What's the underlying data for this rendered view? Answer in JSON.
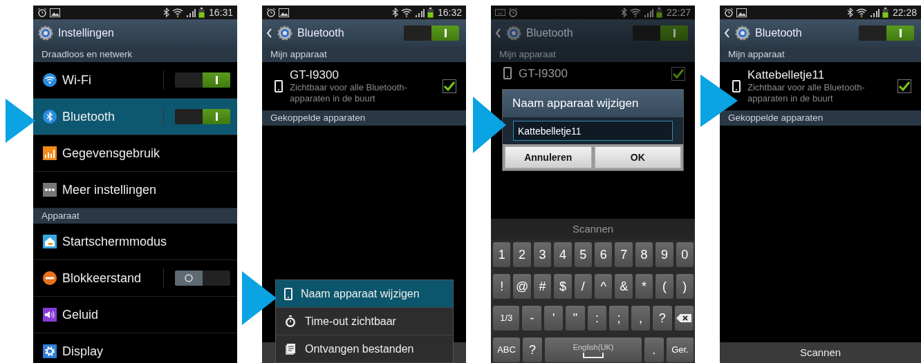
{
  "screens": [
    {
      "kind": "settings",
      "status_bar": {
        "time": "16:31"
      },
      "header": {
        "title": "Instellingen",
        "back": false
      },
      "sections": [
        {
          "title": "Draadloos en netwerk",
          "items": [
            {
              "label": "Wi-Fi",
              "selected": false,
              "on": true
            },
            {
              "label": "Bluetooth",
              "selected": true,
              "on": true
            },
            {
              "label": "Gegevensgebruik",
              "selected": false
            },
            {
              "label": "Meer instellingen",
              "selected": false
            }
          ]
        },
        {
          "title": "Apparaat",
          "items": [
            {
              "label": "Startschermmodus",
              "selected": false
            },
            {
              "label": "Blokkeerstand",
              "selected": false,
              "on": false
            },
            {
              "label": "Geluid",
              "selected": false
            },
            {
              "label": "Display",
              "selected": false
            }
          ]
        }
      ]
    },
    {
      "kind": "bluetooth",
      "dimmed": false,
      "status_bar": {
        "time": "16:32"
      },
      "header": {
        "title": "Bluetooth",
        "back": true,
        "on": true
      },
      "sections": [
        {
          "title": "Mijn apparaat",
          "device": {
            "name": "GT-I9300",
            "description": "Zichtbaar voor alle Bluetooth-apparaten in de buurt",
            "checked": true
          }
        },
        {
          "title": "Gekoppelde apparaten"
        }
      ],
      "menu": [
        {
          "label": "Naam apparaat wijzigen",
          "selected": true
        },
        {
          "label": "Time-out zichtbaar",
          "selected": false
        },
        {
          "label": "Ontvangen bestanden",
          "selected": false
        }
      ]
    },
    {
      "kind": "bluetooth",
      "dimmed": true,
      "status_bar": {
        "time": "22:27"
      },
      "header": {
        "title": "Bluetooth",
        "back": true,
        "on": true
      },
      "sections": [
        {
          "title": "Mijn apparaat",
          "device": {
            "name": "GT-I9300",
            "checked": true
          }
        }
      ],
      "dialog": {
        "title": "Naam apparaat wijzigen",
        "value": "Kattebelletje11",
        "buttons": [
          "Annuleren",
          "OK"
        ]
      },
      "bottom_bar": {
        "label": "Scannen"
      },
      "keyboard": [
        [
          {
            "kind": "char",
            "label": "1"
          },
          {
            "kind": "char",
            "label": "2"
          },
          {
            "kind": "char",
            "label": "3"
          },
          {
            "kind": "char",
            "label": "4"
          },
          {
            "kind": "char",
            "label": "5"
          },
          {
            "kind": "char",
            "label": "6"
          },
          {
            "kind": "char",
            "label": "7"
          },
          {
            "kind": "char",
            "label": "8"
          },
          {
            "kind": "char",
            "label": "9"
          },
          {
            "kind": "char",
            "label": "0"
          }
        ],
        [
          {
            "kind": "char",
            "label": "!"
          },
          {
            "kind": "char",
            "label": "@"
          },
          {
            "kind": "char",
            "label": "#"
          },
          {
            "kind": "char",
            "label": "$"
          },
          {
            "kind": "char",
            "label": "/"
          },
          {
            "kind": "char",
            "label": "^"
          },
          {
            "kind": "char",
            "label": "&"
          },
          {
            "kind": "char",
            "label": "*"
          },
          {
            "kind": "char",
            "label": "("
          },
          {
            "kind": "char",
            "label": ")"
          }
        ],
        [
          {
            "kind": "wide",
            "label": "1/3"
          },
          {
            "kind": "char",
            "label": "-"
          },
          {
            "kind": "char",
            "label": "'"
          },
          {
            "kind": "char",
            "label": "\""
          },
          {
            "kind": "char",
            "label": ":"
          },
          {
            "kind": "char",
            "label": ";"
          },
          {
            "kind": "char",
            "label": ","
          },
          {
            "kind": "char",
            "label": "?"
          },
          {
            "kind": "backspace"
          }
        ],
        [
          {
            "kind": "wide",
            "label": "ABC"
          },
          {
            "kind": "char",
            "label": "?"
          },
          {
            "kind": "space",
            "label": "English(UK)"
          },
          {
            "kind": "char",
            "label": "."
          },
          {
            "kind": "wide",
            "label": "Ger."
          }
        ]
      ]
    },
    {
      "kind": "bluetooth",
      "dimmed": false,
      "status_bar": {
        "time": "22:28"
      },
      "header": {
        "title": "Bluetooth",
        "back": true,
        "on": true
      },
      "sections": [
        {
          "title": "Mijn apparaat",
          "device": {
            "name": "Kattebelletje11",
            "description": "Zichtbaar voor alle Bluetooth-apparaten in de buurt",
            "checked": true
          }
        },
        {
          "title": "Gekoppelde apparaten"
        }
      ],
      "bottom_bar": {
        "label": "Scannen"
      }
    }
  ]
}
